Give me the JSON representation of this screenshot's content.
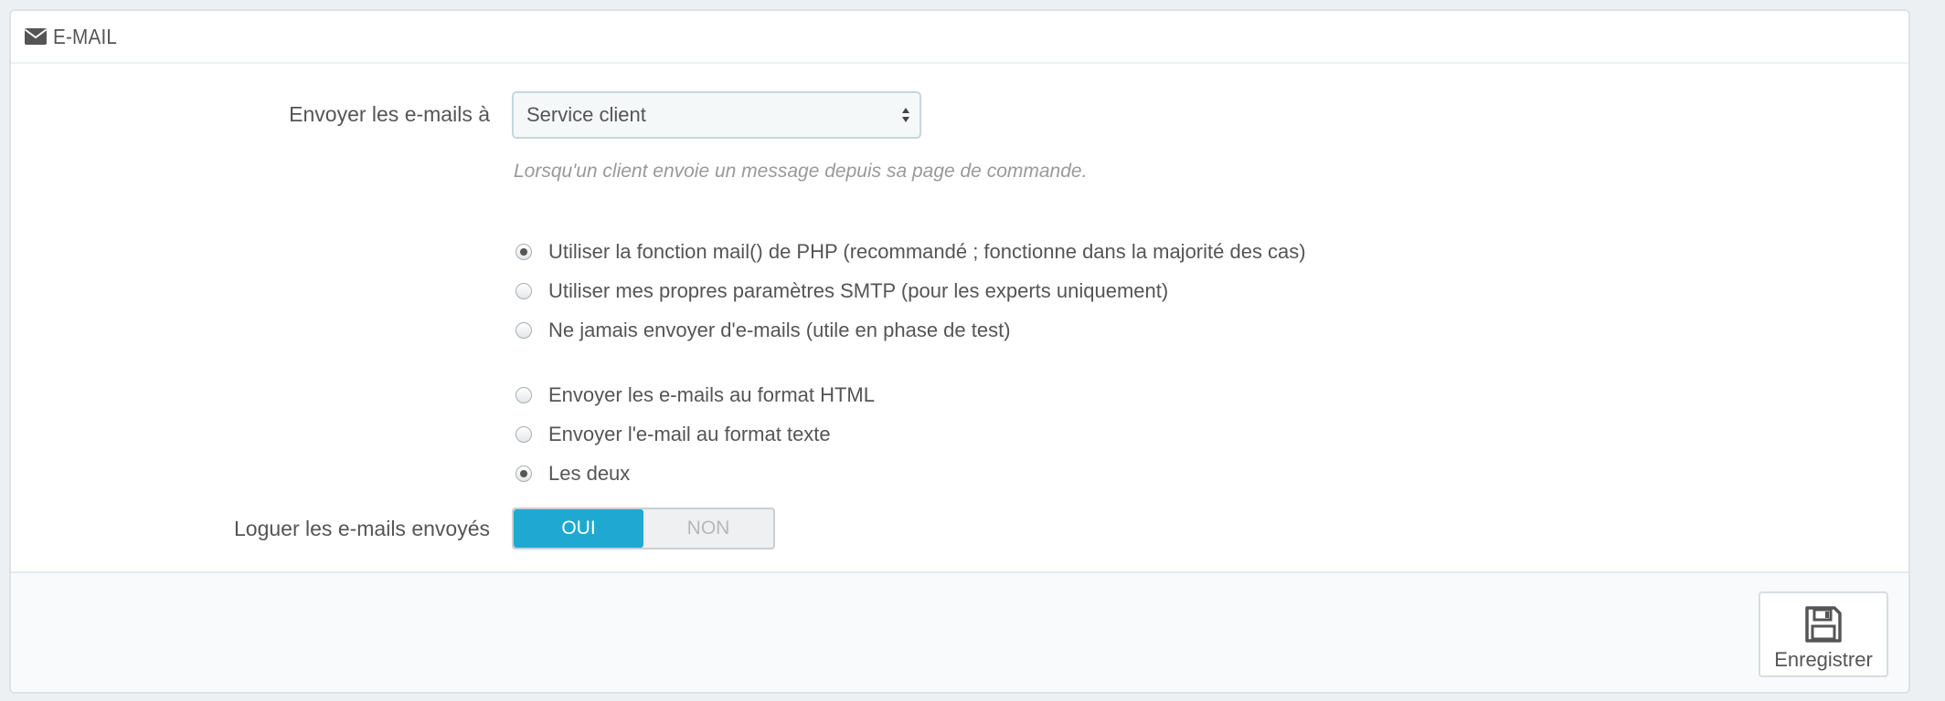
{
  "panel": {
    "title": "E-MAIL",
    "icon": "envelope-icon"
  },
  "form": {
    "send_to_label": "Envoyer les e-mails à",
    "send_to_value": "Service client",
    "send_to_help": "Lorsqu'un client envoie un message depuis sa page de commande.",
    "method_options": [
      {
        "label": "Utiliser la fonction mail() de PHP (recommandé ; fonctionne dans la majorité des cas)",
        "checked": true
      },
      {
        "label": "Utiliser mes propres paramètres SMTP (pour les experts uniquement)",
        "checked": false
      },
      {
        "label": "Ne jamais envoyer d'e-mails (utile en phase de test)",
        "checked": false
      }
    ],
    "format_options": [
      {
        "label": "Envoyer les e-mails au format HTML",
        "checked": false
      },
      {
        "label": "Envoyer l'e-mail au format texte",
        "checked": false
      },
      {
        "label": "Les deux",
        "checked": true
      }
    ],
    "log_label": "Loguer les e-mails envoyés",
    "log_yes": "OUI",
    "log_no": "NON",
    "log_selected": "OUI"
  },
  "footer": {
    "save_label": "Enregistrer",
    "save_icon": "floppy-disk-icon"
  },
  "colors": {
    "accent": "#1fa9d2",
    "text": "#555555",
    "help_text": "#999999"
  }
}
